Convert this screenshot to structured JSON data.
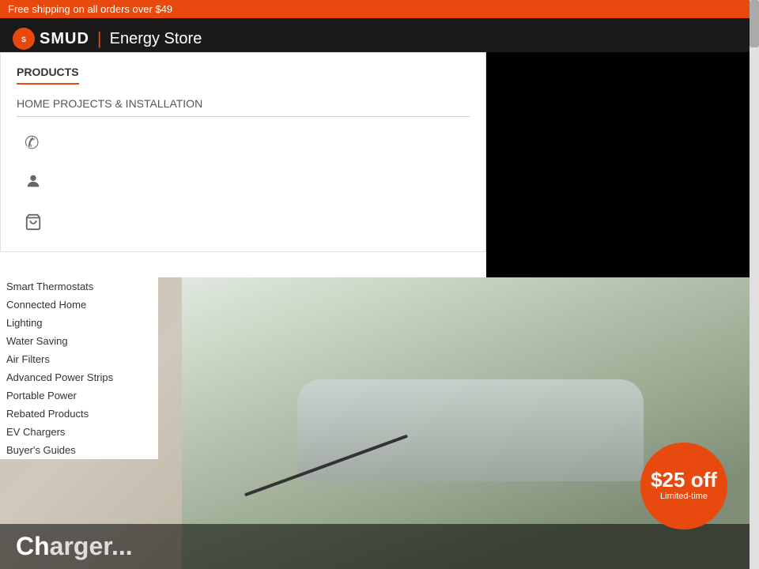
{
  "topBanner": {
    "text": "Free shipping on all orders over $49"
  },
  "header": {
    "logoMark": "●",
    "logoName": "SMUD",
    "separator": "|",
    "storeName": "Energy Store"
  },
  "dropdown": {
    "productsLabel": "PRODUCTS",
    "homeProjectsLabel": "HOME PROJECTS & INSTALLATION",
    "phoneIcon": "📞",
    "userIcon": "👤",
    "cartIcon": "🛒"
  },
  "sidebarNav": {
    "items": [
      {
        "label": "Smart Thermostats",
        "url": "#"
      },
      {
        "label": "Connected Home",
        "url": "#"
      },
      {
        "label": "Lighting",
        "url": "#"
      },
      {
        "label": "Water Saving",
        "url": "#"
      },
      {
        "label": "Air Filters",
        "url": "#"
      },
      {
        "label": "Advanced Power Strips",
        "url": "#"
      },
      {
        "label": "Portable Power",
        "url": "#"
      },
      {
        "label": "Rebated Products",
        "url": "#"
      },
      {
        "label": "EV Chargers",
        "url": "#"
      },
      {
        "label": "Buyer's Guides",
        "url": "#"
      }
    ]
  },
  "hero": {
    "titleStart": "Ch",
    "discount": {
      "amount": "$25 off",
      "label": "Limited-time"
    }
  }
}
